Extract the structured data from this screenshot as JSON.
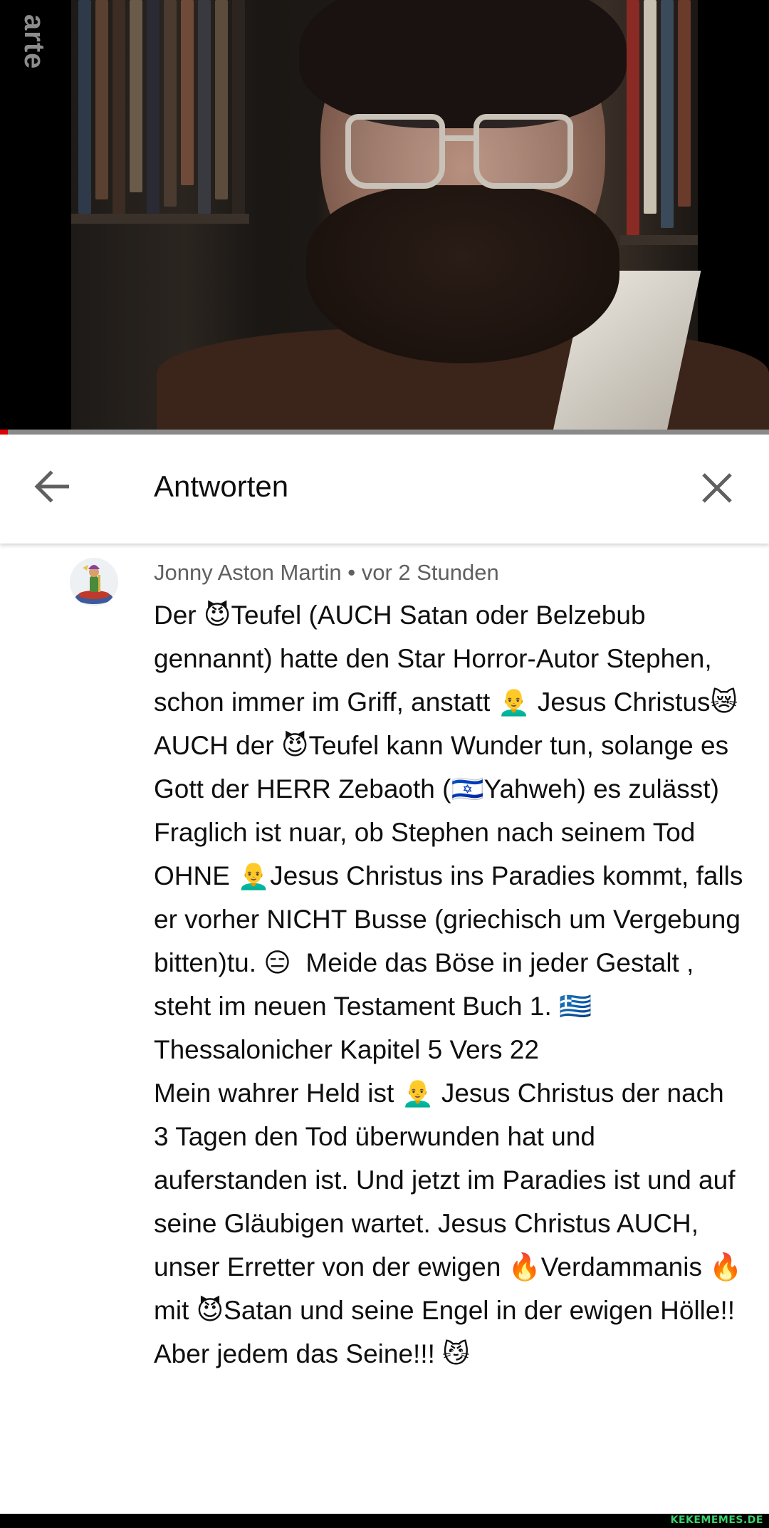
{
  "video": {
    "channel_logo": "arte",
    "progress_fraction": 0.01,
    "progress_color": "#e00000"
  },
  "header": {
    "back_icon": "arrow-left-icon",
    "title": "Antworten",
    "close_icon": "close-icon"
  },
  "comment": {
    "author": "Jonny Aston Martin",
    "timestamp": "vor 2 Stunden",
    "meta": "Jonny Aston Martin • vor 2 Stunden",
    "text": "Der 😈Teufel (AUCH Satan oder Belzebub gennannt) hatte den Star Horror-Autor Stephen, schon immer im Griff, anstatt 👨‍🦲 Jesus Christus😿  AUCH der 😈Teufel kann Wunder tun, solange es Gott der HERR Zebaoth (🇮🇱Yahweh) es zulässt) Fraglich ist nuar, ob Stephen nach seinem Tod OHNE 👨‍🦲Jesus Christus ins Paradies kommt, falls er vorher NICHT Busse (griechisch um Vergebung bitten)tu. 😑  Meide das Böse in jeder Gestalt , steht im neuen Testament Buch 1. 🇬🇷Thessalonicher Kapitel 5 Vers 22\nMein wahrer Held ist 👨‍🦲 Jesus Christus der nach 3 Tagen den Tod überwunden hat und auferstanden ist. Und jetzt im Paradies ist und auf seine Gläubigen wartet. Jesus Christus AUCH, unser Erretter von der ewigen 🔥Verdammanis 🔥mit 😈Satan und seine Engel in der ewigen Hölle!! Aber jedem das Seine!!! 😼"
  },
  "footer": {
    "watermark": "KEKEMEMES.DE"
  }
}
